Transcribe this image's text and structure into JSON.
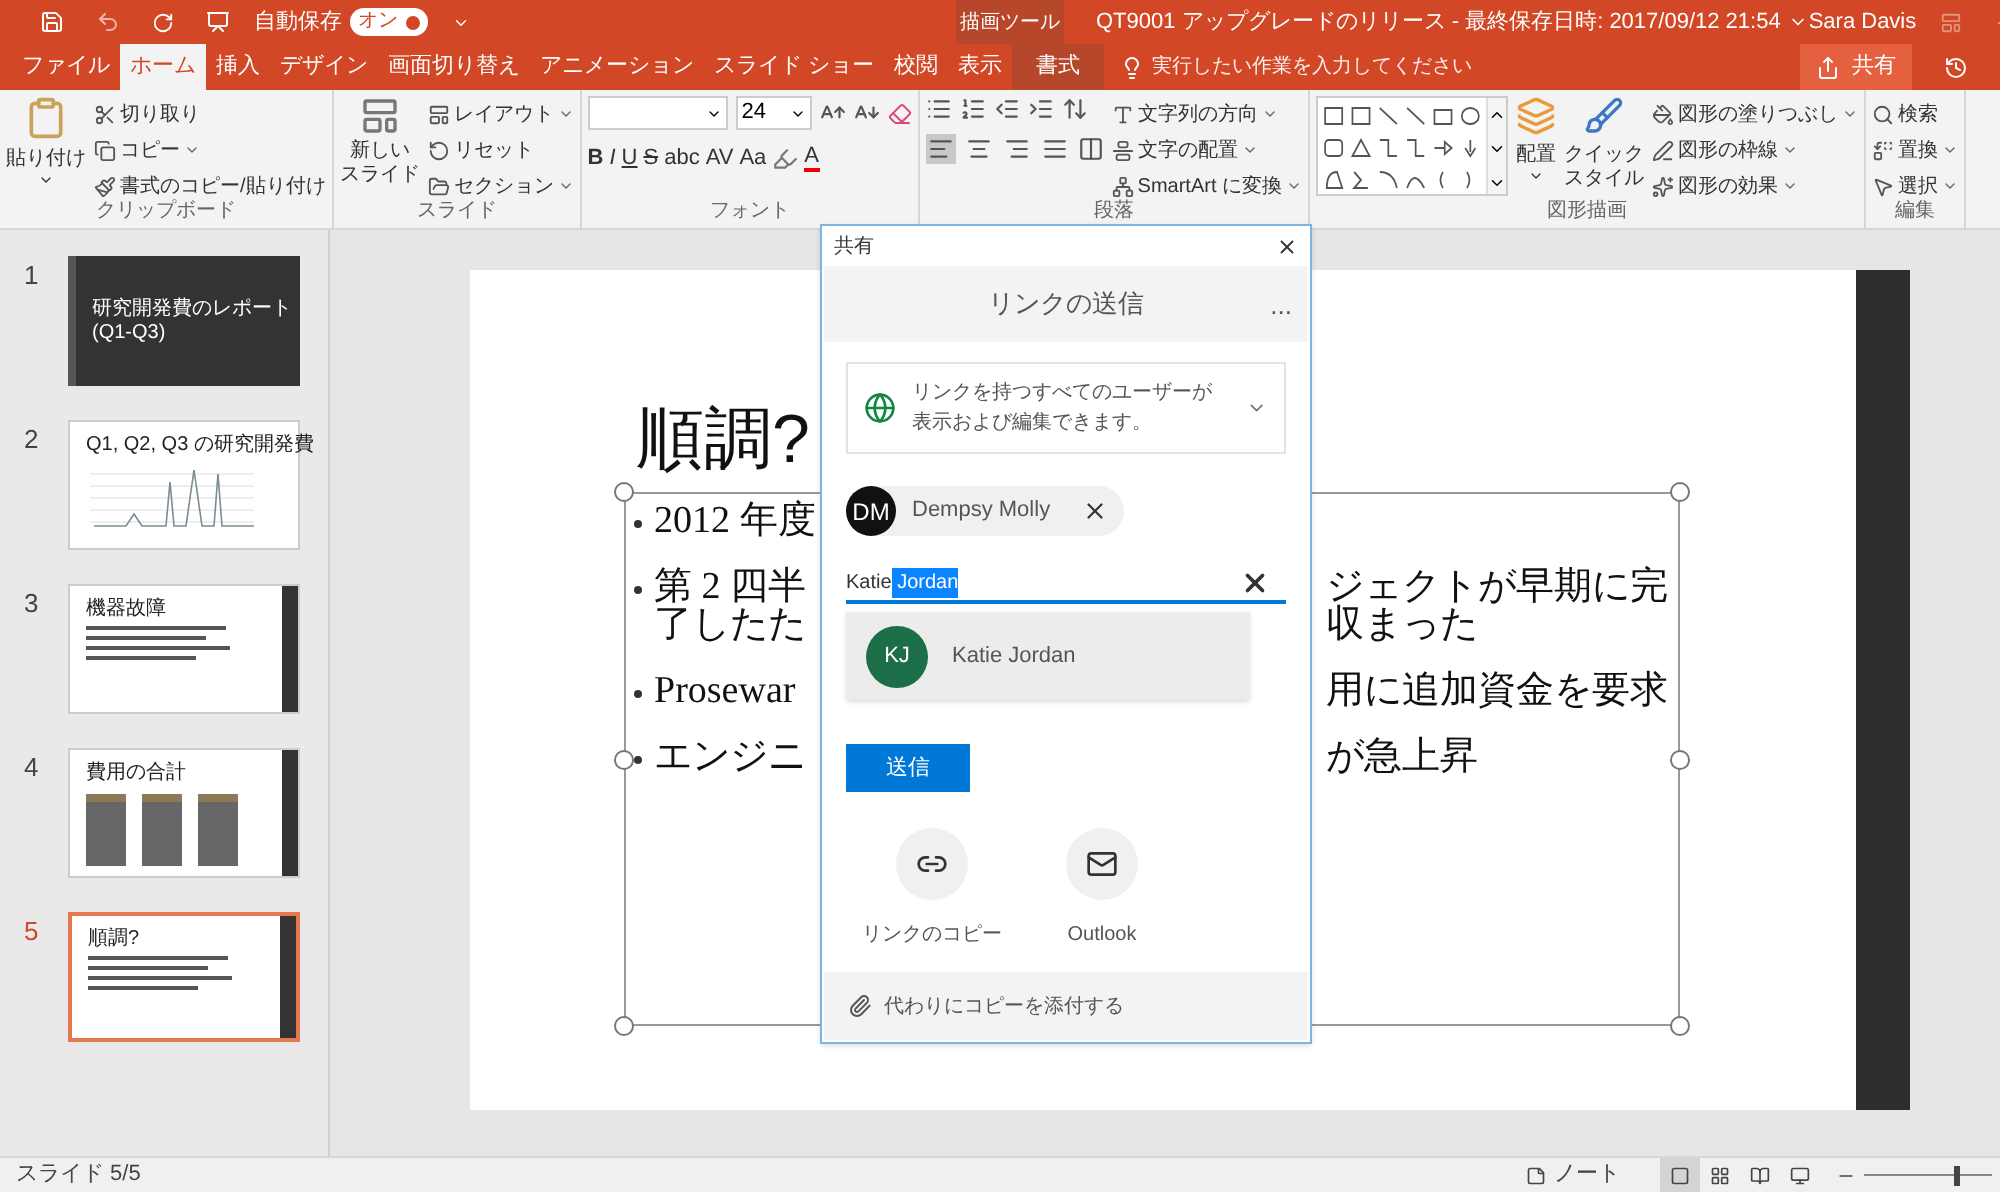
{
  "title_bar": {
    "autosave_label": "自動保存",
    "autosave": {
      "label": "オン",
      "on": true
    },
    "context_tab": "描画ツール",
    "document_title": "QT9001 アップグレードのリリース - 最終保存日時: 2017/09/12 21:54",
    "user": "Sara Davis"
  },
  "tabs": [
    {
      "label": "ファイル",
      "selected": false,
      "kind": "normal"
    },
    {
      "label": "ホーム",
      "selected": true,
      "kind": "normal"
    },
    {
      "label": "挿入",
      "selected": false,
      "kind": "normal"
    },
    {
      "label": "デザイン",
      "selected": false,
      "kind": "normal"
    },
    {
      "label": "画面切り替え",
      "selected": false,
      "kind": "normal"
    },
    {
      "label": "アニメーション",
      "selected": false,
      "kind": "normal"
    },
    {
      "label": "スライド ショー",
      "selected": false,
      "kind": "normal"
    },
    {
      "label": "校閲",
      "selected": false,
      "kind": "normal"
    },
    {
      "label": "表示",
      "selected": false,
      "kind": "normal"
    },
    {
      "label": "書式",
      "selected": false,
      "kind": "context"
    }
  ],
  "tell_me": {
    "placeholder": "実行したい作業を入力してください"
  },
  "share_button": "共有",
  "ribbon": {
    "clipboard": {
      "label": "クリップボード",
      "paste": "貼り付け",
      "items": [
        "切り取り",
        "コピー",
        "書式のコピー/貼り付け"
      ]
    },
    "slides": {
      "label": "スライド",
      "new_slide": [
        "新しい",
        "スライド"
      ],
      "items": [
        "レイアウト",
        "リセット",
        "セクション"
      ]
    },
    "font": {
      "label": "フォント",
      "size": "24",
      "format_buttons": [
        "B",
        "I",
        "U",
        "S",
        "abc",
        "AV",
        "Aa"
      ],
      "font_color": "A"
    },
    "paragraph": {
      "label": "段落",
      "alignments": [
        {
          "kind": "left",
          "selected": true
        },
        {
          "kind": "center",
          "selected": false
        },
        {
          "kind": "right",
          "selected": false
        },
        {
          "kind": "justify",
          "selected": false
        }
      ],
      "items": [
        "文字列の方向",
        "文字の配置",
        "SmartArt に変換"
      ]
    },
    "drawing": {
      "label": "図形描画",
      "arrange": "配置",
      "quick_styles": [
        "クイック",
        "スタイル"
      ],
      "items": [
        "図形の塗りつぶし",
        "図形の枠線",
        "図形の効果"
      ]
    },
    "editing": {
      "label": "編集",
      "items": [
        "検索",
        "置換",
        "選択"
      ]
    }
  },
  "slides": [
    {
      "number": "1",
      "kind": "title",
      "title": "研究開発費のレポート",
      "subtitle": "(Q1-Q3)",
      "selected": false
    },
    {
      "number": "2",
      "kind": "chart",
      "title": "Q1, Q2, Q3 の研究開発費",
      "selected": false
    },
    {
      "number": "3",
      "kind": "text",
      "title": "機器故障",
      "selected": false
    },
    {
      "number": "4",
      "kind": "cards",
      "title": "費用の合計",
      "selected": false
    },
    {
      "number": "5",
      "kind": "text",
      "title": "順調?",
      "selected": true
    }
  ],
  "slide": {
    "title": "順調?",
    "bullets": [
      {
        "lines": [
          {
            "left": "2012 年度"
          }
        ]
      },
      {
        "lines": [
          {
            "left": "第 2 四半",
            "right": "ジェクトが早期に完"
          },
          {
            "left": "了したた",
            "right": "収まった"
          }
        ]
      },
      {
        "lines": [
          {
            "left": "Prosewar",
            "right": "用に追加資金を要求"
          }
        ]
      },
      {
        "lines": [
          {
            "left": "エンジニ",
            "right": "が急上昇"
          }
        ]
      }
    ]
  },
  "share_dialog": {
    "title": "共有",
    "heading": "リンクの送信",
    "more": "...",
    "link_setting": "リンクを持つすべてのユーザーが表示および編集できます。",
    "recipients": [
      {
        "initials": "DM",
        "name": "Dempsy Molly"
      }
    ],
    "input": [
      {
        "text": "Katie",
        "highlighted": false
      },
      {
        "text": " Jordan",
        "highlighted": true
      }
    ],
    "suggestions": [
      {
        "initials": "KJ",
        "name": "Katie Jordan"
      }
    ],
    "send_button": "送信",
    "actions": [
      {
        "kind": "link",
        "label": "リンクのコピー"
      },
      {
        "kind": "outlook",
        "label": "Outlook"
      }
    ],
    "attach": "代わりにコピーを添付する"
  },
  "status_bar": {
    "slide_info": "スライド 5/5",
    "notes": "ノート",
    "views": [
      {
        "kind": "normal",
        "selected": true
      },
      {
        "kind": "sorter",
        "selected": false
      },
      {
        "kind": "reading",
        "selected": false
      },
      {
        "kind": "show",
        "selected": false
      }
    ],
    "zoom": {
      "level": 0.72
    }
  }
}
